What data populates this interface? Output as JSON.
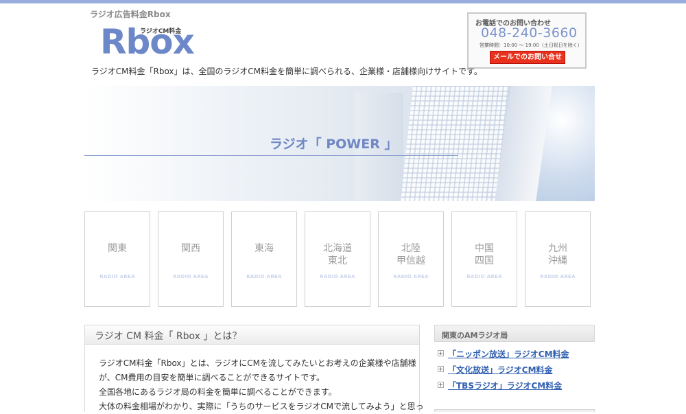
{
  "header": {
    "site_name": "ラジオ広告料金Rbox",
    "logo_text": "Rbox",
    "logo_sub": "ラジオCM料金",
    "tagline": "ラジオCM料金「Rbox」は、全国のラジオCM料金を簡単に調べられる、企業様・店舗様向けサイトです。"
  },
  "contact": {
    "title": "お電話でのお問い合わせ",
    "phone": "048-240-3660",
    "hours": "営業時間：10:00 〜 19:00（土日祝日を除く）",
    "mail_button": "メールでのお問い合せ"
  },
  "hero": {
    "title": "ラジオ「 POWER 」"
  },
  "areas": [
    {
      "name": "関東",
      "sub": "RADIO AREA"
    },
    {
      "name": "関西",
      "sub": "RADIO AREA"
    },
    {
      "name": "東海",
      "sub": "RADIO AREA"
    },
    {
      "name": "北海道\n東北",
      "sub": "RADIO AREA"
    },
    {
      "name": "北陸\n甲信越",
      "sub": "RADIO AREA"
    },
    {
      "name": "中国\n四国",
      "sub": "RADIO AREA"
    },
    {
      "name": "九州\n沖縄",
      "sub": "RADIO AREA"
    }
  ],
  "about": {
    "title": "ラジオ CM 料金「 Rbox 」とは？",
    "lines": [
      "ラジオCM料金「Rbox」とは、ラジオにCMを流してみたいとお考えの企業様や店舗様",
      "が、CM費用の目安を簡単に調べることができるサイトです。",
      "全国各地にあるラジオ局の料金を簡単に調べることができます。",
      "大体の料金相場がわかり、実際に「うちのサービスをラジオCMで流してみよう」と思っ"
    ]
  },
  "sidebar": {
    "title": "関東のAMラジオ局",
    "items": [
      {
        "label": "「ニッポン放送」ラジオCM料金"
      },
      {
        "label": "「文化放送」ラジオCM料金"
      },
      {
        "label": "「TBSラジオ」ラジオCM料金"
      }
    ]
  }
}
